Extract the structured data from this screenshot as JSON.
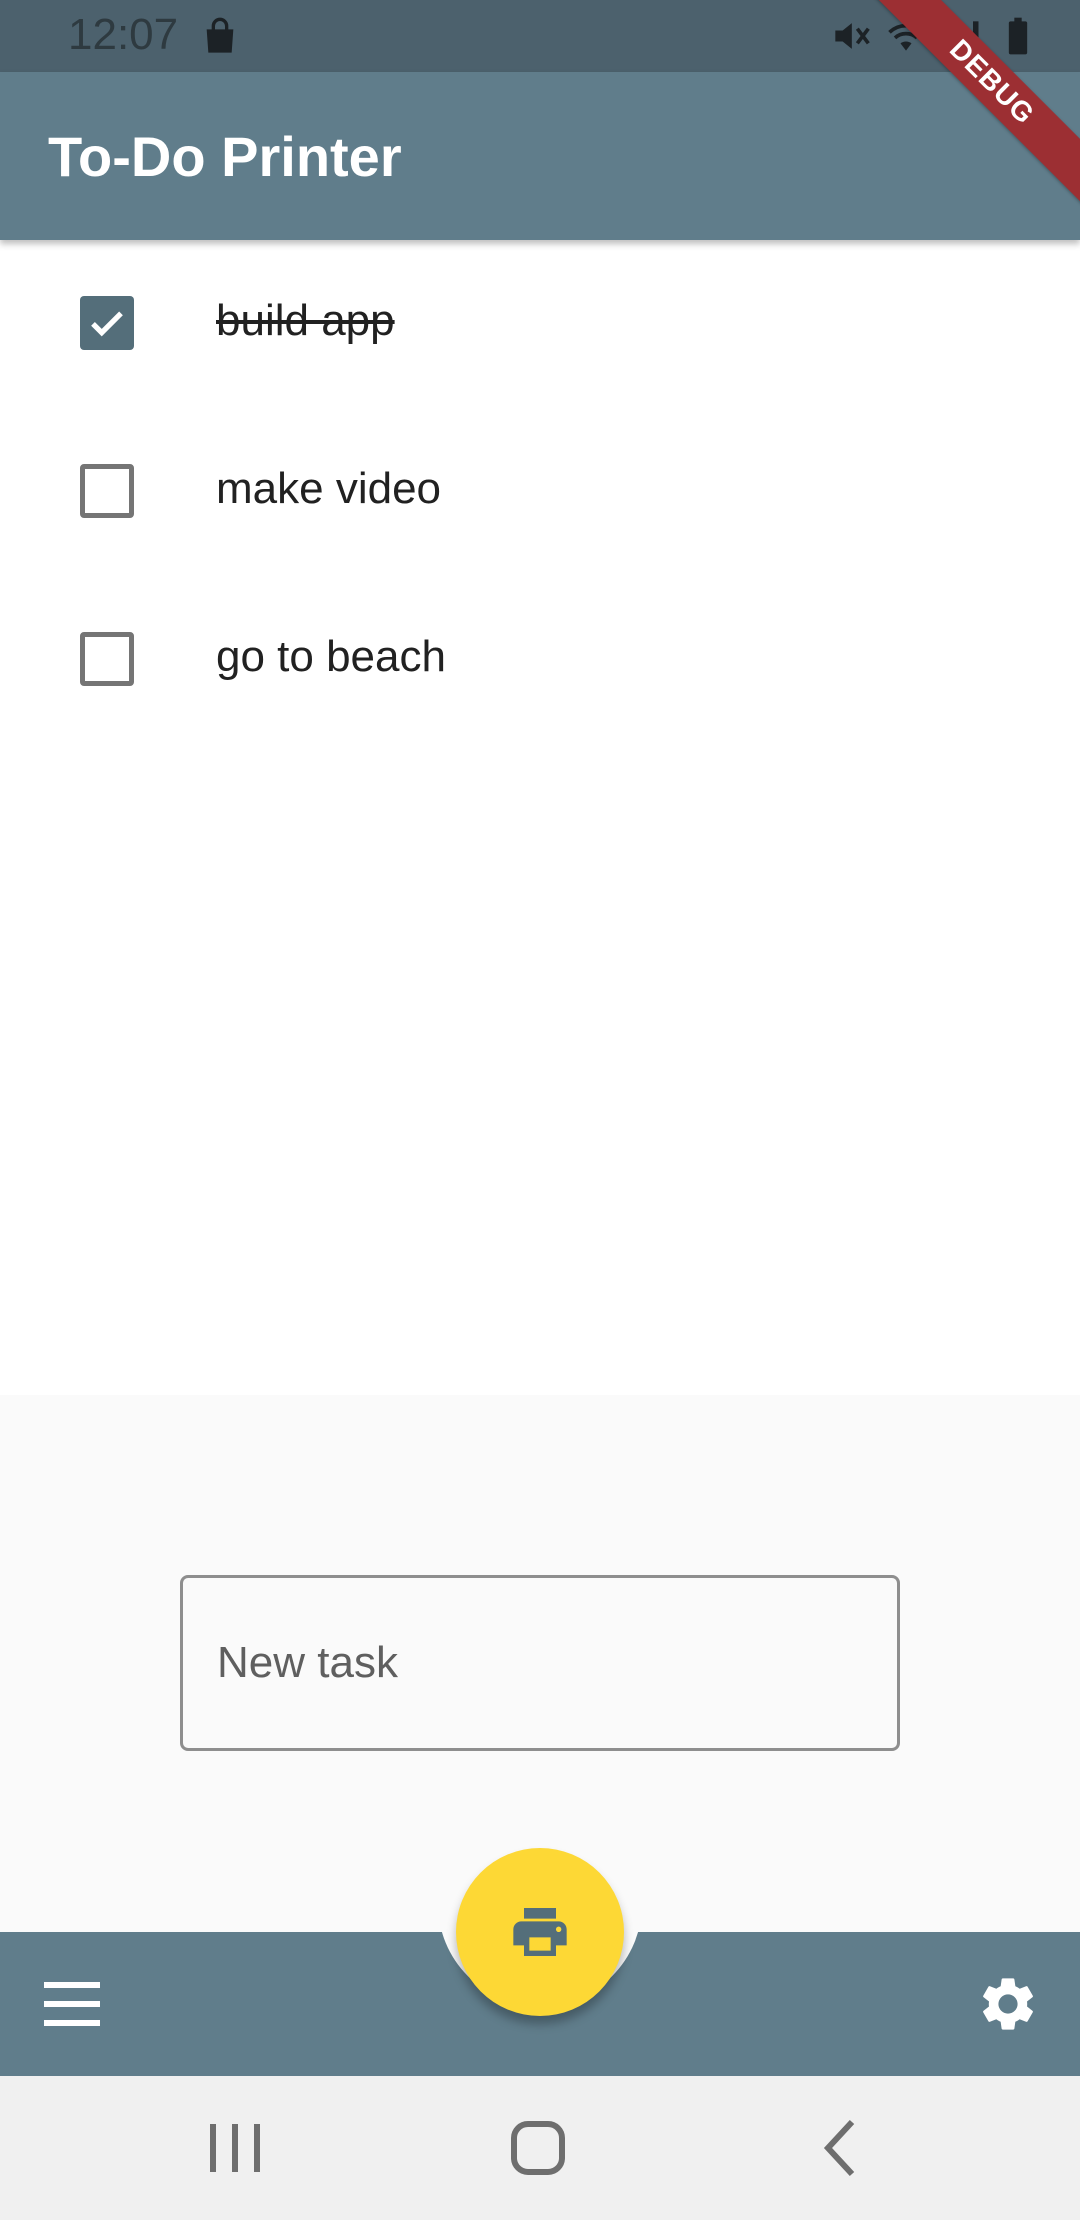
{
  "status_bar": {
    "time": "12:07",
    "icons": [
      "shopping-bag-icon",
      "mute-icon",
      "wifi-icon",
      "signal-icon",
      "battery-icon"
    ]
  },
  "app_bar": {
    "title": "To-Do Printer",
    "debug_label": "DEBUG",
    "color": "#607d8b"
  },
  "tasks": [
    {
      "label": "build app",
      "done": true
    },
    {
      "label": "make video",
      "done": false
    },
    {
      "label": "go to beach",
      "done": false
    }
  ],
  "new_task": {
    "placeholder": "New task",
    "value": ""
  },
  "bottom_bar": {
    "left_icon": "menu-icon",
    "right_icon": "settings-icon",
    "fab_icon": "print-icon",
    "fab_color": "#fdd835"
  },
  "system_nav": {
    "icons": [
      "recent-apps-icon",
      "home-icon",
      "back-icon"
    ]
  }
}
